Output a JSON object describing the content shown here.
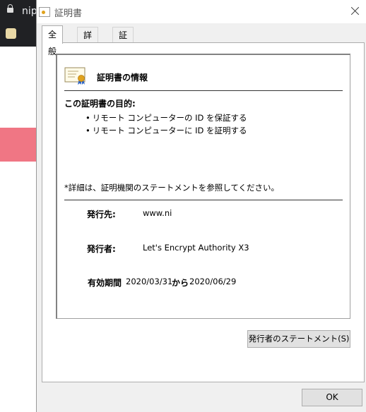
{
  "browser": {
    "url_text": "nip"
  },
  "dialog": {
    "title": "証明書",
    "tabs": [
      {
        "label": "全般"
      },
      {
        "label": "詳細"
      },
      {
        "label": "証明のパス"
      }
    ],
    "info_title": "証明書の情報",
    "purpose_heading": "この証明書の目的:",
    "purposes": [
      "リモート コンピューターの ID を保証する",
      "リモート コンピューターに ID を証明する"
    ],
    "note": "*詳細は、証明機関のステートメントを参照してください。",
    "issued_to_label": "発行先:",
    "issued_to_value": "www.ni",
    "issued_by_label": "発行者:",
    "issued_by_value": "Let's Encrypt Authority X3",
    "validity_label": "有効期間",
    "valid_from": "2020/03/31",
    "validity_sep": "から",
    "valid_to": "2020/06/29",
    "statement_button": "発行者のステートメント(S)",
    "ok_button": "OK"
  },
  "colors": {
    "accent_band": "#f07684",
    "seal": "#e0a21c"
  }
}
